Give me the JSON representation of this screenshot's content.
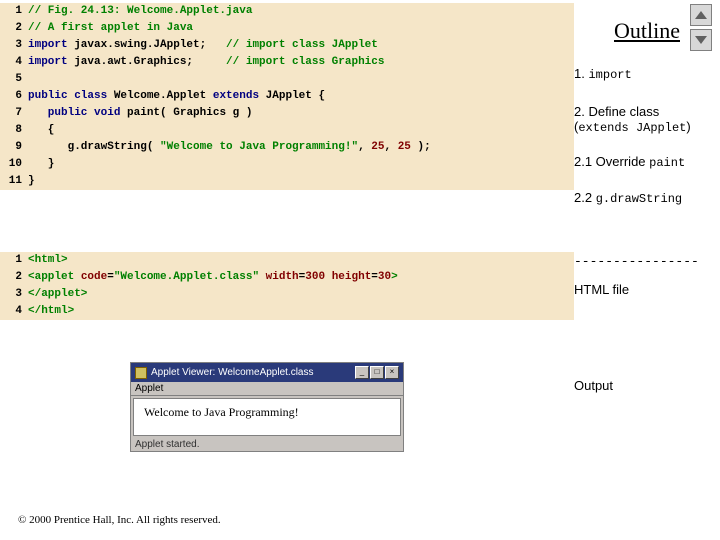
{
  "code1": {
    "l1": "// Fig. 24.13: Welcome.Applet.java",
    "l2": "// A first applet in Java",
    "l3a": "import",
    "l3b": " javax.swing.JApplet;   ",
    "l3c": "// import class JApplet",
    "l4a": "import",
    "l4b": " java.awt.Graphics;     ",
    "l4c": "// import class Graphics",
    "l6a": "public class ",
    "l6b": "Welcome.Applet ",
    "l6c": "extends ",
    "l6d": "JApplet {",
    "l7a": "   public void ",
    "l7b": "paint( Graphics g )",
    "l8": "   {",
    "l9a": "      g.drawString( ",
    "l9b": "\"Welcome to Java Programming!\"",
    "l9c": ", ",
    "l9d": "25",
    "l9e": ", ",
    "l9f": "25",
    "l9g": " );",
    "l10": "   }",
    "l11": "}"
  },
  "ln": {
    "n1": "1",
    "n2": "2",
    "n3": "3",
    "n4": "4",
    "n5": "5",
    "n6": "6",
    "n7": "7",
    "n8": "8",
    "n9": "9",
    "n10": "10",
    "n11": "11"
  },
  "code2": {
    "l1a": "<html>",
    "l2a": "<applet ",
    "l2b": "code",
    "l2c": "=",
    "l2d": "\"Welcome.Applet.class\" ",
    "l2e": "width",
    "l2f": "=",
    "l2g": "300 ",
    "l2h": "height",
    "l2i": "=",
    "l2j": "30",
    "l2k": ">",
    "l3": "</applet>",
    "l4": "</html>"
  },
  "ln2": {
    "n1": "1",
    "n2": "2",
    "n3": "3",
    "n4": "4"
  },
  "outline": "Outline",
  "notes": {
    "n1a": "1. ",
    "n1b": "import",
    "n2a": "2. Define class",
    "n2b": "(",
    "n2c": "extends JApplet",
    "n2d": ")",
    "n3a": "2.1 Override ",
    "n3b": "paint",
    "n4a": "2.2 ",
    "n4b": "g.drawString",
    "dashes": "----------------",
    "htmlfile": "HTML file",
    "output": "Output"
  },
  "applet": {
    "title": "Applet Viewer: WelcomeApplet.class",
    "menu": "Applet",
    "msg": "Welcome to Java Programming!",
    "status": "Applet started."
  },
  "copyright": "© 2000 Prentice Hall, Inc. All rights reserved."
}
